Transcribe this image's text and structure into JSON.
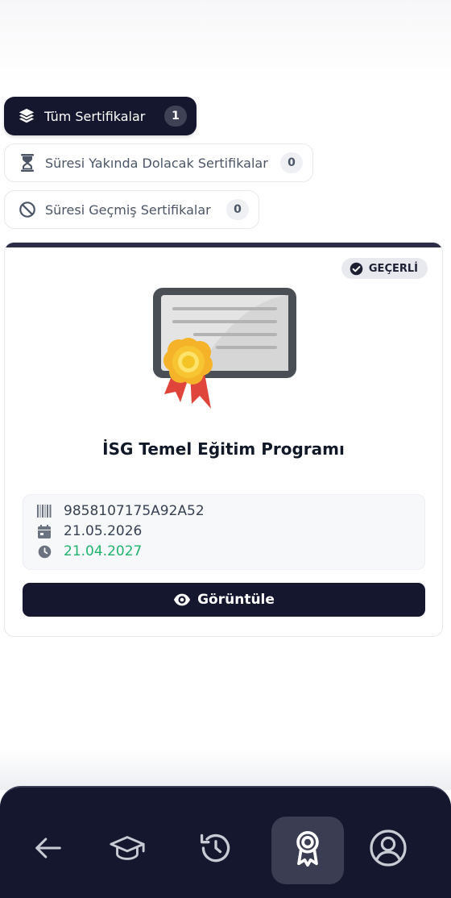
{
  "filters": {
    "all": {
      "label": "Tüm Sertifikalar",
      "count": "1",
      "icon": "layers-icon"
    },
    "expiring": {
      "label": "Süresi Yakında Dolacak Sertifikalar",
      "count": "0",
      "icon": "hourglass-icon"
    },
    "expired": {
      "label": "Süresi Geçmiş Sertifikalar",
      "count": "0",
      "icon": "ban-icon"
    }
  },
  "certificate": {
    "status": "GEÇERLİ",
    "title": "İSG Temel Eğitim Programı",
    "code": "9858107175A92A52",
    "issue_date": "21.05.2026",
    "expiry_date": "21.04.2027",
    "view_label": "Görüntüle"
  },
  "nav": {
    "items": [
      "back-arrow-icon",
      "graduation-cap-icon",
      "history-icon",
      "award-icon",
      "user-circle-icon"
    ],
    "active": "award-icon"
  },
  "colors": {
    "primary": "#15172e",
    "valid_green": "#21b36d",
    "badge_bg": "#e7e9ee"
  }
}
